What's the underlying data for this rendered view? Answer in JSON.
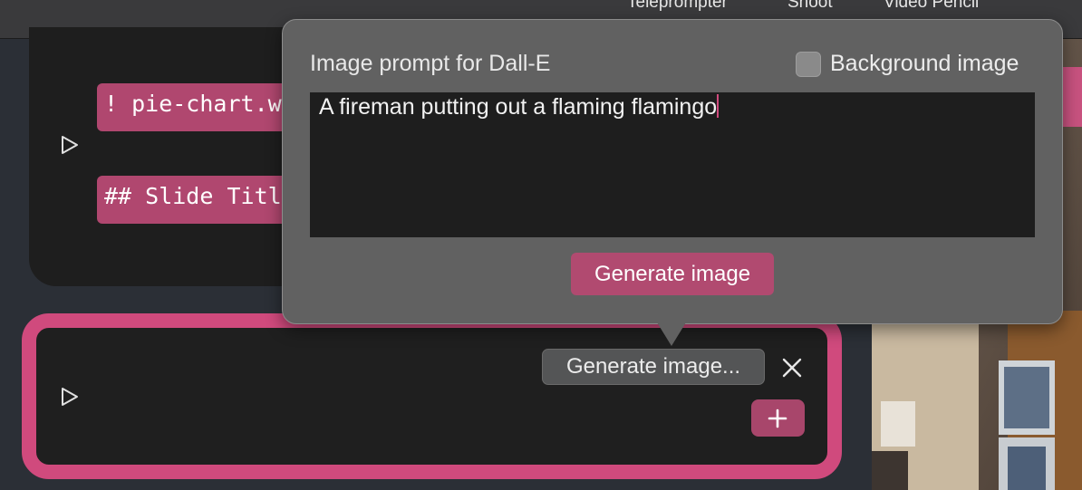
{
  "toolbar": {
    "tabs": [
      "Teleprompter",
      "Shoot",
      "Video Pencil"
    ]
  },
  "slides": {
    "code_lines": [
      "! pie-chart.w",
      "## Slide Titl"
    ],
    "generate_chip_label": "Generate image..."
  },
  "popover": {
    "label": "Image prompt for Dall-E",
    "background_image_label": "Background image",
    "background_image_checked": false,
    "prompt_value": "A fireman putting out a flaming flamingo",
    "generate_button_label": "Generate image"
  },
  "icons": {
    "play": "play-icon",
    "close": "close-icon",
    "plus": "plus-icon",
    "checkbox": "checkbox"
  },
  "colors": {
    "accent": "#d04a7d",
    "chip": "#b0476f",
    "popover_bg": "#616161",
    "panel_bg": "#2b2f36"
  }
}
